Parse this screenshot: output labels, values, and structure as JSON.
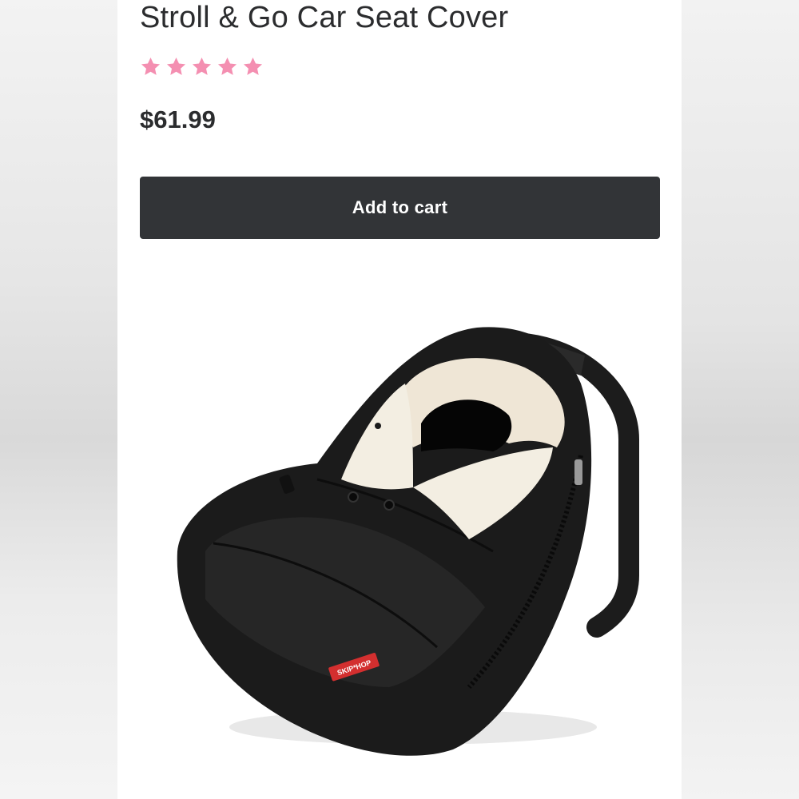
{
  "product": {
    "title": "Stroll & Go Car Seat Cover",
    "rating_stars": 5,
    "rating_max": 5,
    "price": "$61.99"
  },
  "actions": {
    "add_to_cart_label": "Add to cart"
  },
  "image": {
    "brand_tag": "SKIP*HOP"
  },
  "colors": {
    "star": "#f48fb1",
    "button_bg": "#323437",
    "button_text": "#ffffff",
    "title_text": "#2b2c2e",
    "brand_tag": "#d32f2f"
  }
}
